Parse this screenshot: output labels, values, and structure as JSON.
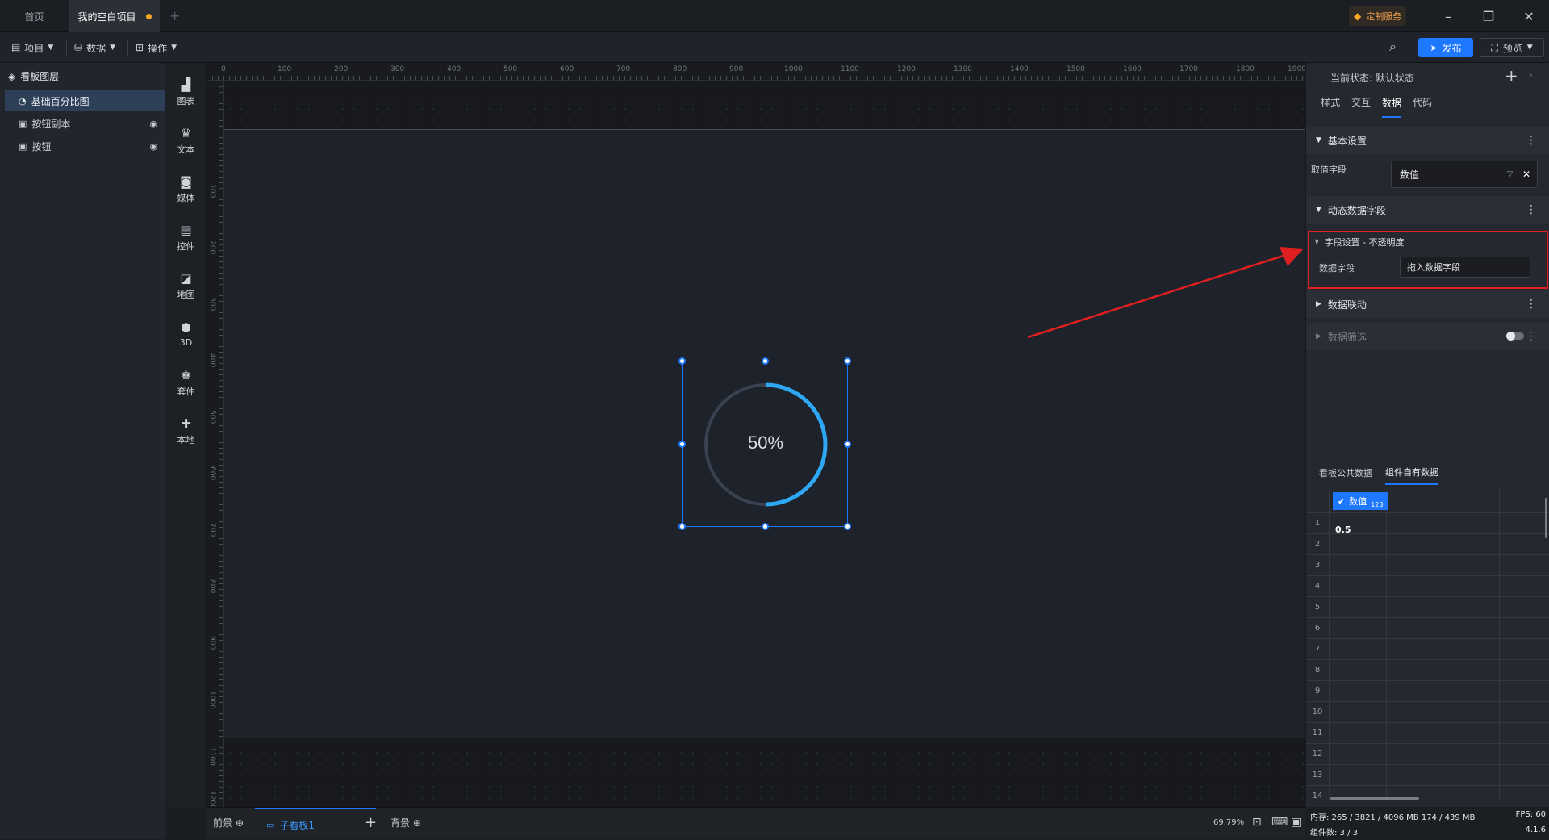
{
  "titlebar": {
    "tabs": [
      {
        "label": "首页"
      },
      {
        "label": "我的空白项目"
      }
    ],
    "custom_service": "定制服务"
  },
  "toolbar": {
    "menus": [
      {
        "label": "项目"
      },
      {
        "label": "数据"
      },
      {
        "label": "操作"
      }
    ],
    "publish": "发布",
    "preview": "预览"
  },
  "layers": {
    "title": "看板图层",
    "items": [
      {
        "label": "基础百分比图"
      },
      {
        "label": "按钮副本"
      },
      {
        "label": "按钮"
      }
    ]
  },
  "iconbar": {
    "items": [
      {
        "label": "图表",
        "icon": "chart-icon"
      },
      {
        "label": "文本",
        "icon": "text-icon"
      },
      {
        "label": "媒体",
        "icon": "media-icon"
      },
      {
        "label": "控件",
        "icon": "control-icon"
      },
      {
        "label": "地图",
        "icon": "map-icon"
      },
      {
        "label": "3D",
        "icon": "cube-icon"
      },
      {
        "label": "套件",
        "icon": "suite-icon"
      },
      {
        "label": "本地",
        "icon": "puzzle-icon"
      }
    ]
  },
  "ruler": {
    "top": [
      "0",
      "100",
      "200",
      "300",
      "400",
      "500",
      "600",
      "700",
      "800",
      "900",
      "1000",
      "1100",
      "1200",
      "1300",
      "1400",
      "1500",
      "1600",
      "1700",
      "1800",
      "1900"
    ],
    "left": [
      "100",
      "200",
      "300",
      "400",
      "500",
      "600",
      "700",
      "800",
      "900",
      "1000",
      "1100",
      "1200"
    ]
  },
  "canvas": {
    "gauge_label": "50%",
    "gauge_value": 0.5
  },
  "bottom": {
    "foreground": "前景",
    "sub_board": "子看板1",
    "background": "背景",
    "zoom": "69.79%"
  },
  "panel": {
    "state_label": "当前状态: 默认状态",
    "tabs": [
      {
        "label": "样式"
      },
      {
        "label": "交互"
      },
      {
        "label": "数据"
      },
      {
        "label": "代码"
      }
    ],
    "basic_settings": "基本设置",
    "value_field_label": "取值字段",
    "value_field_value": "数值",
    "dynamic_fields": "动态数据字段",
    "field_settings": "字段设置 - 不透明度",
    "data_field_label": "数据字段",
    "data_field_placeholder": "拖入数据字段",
    "data_link": "数据联动",
    "data_filter": "数据筛选",
    "data_tabs": [
      {
        "label": "看板公共数据"
      },
      {
        "label": "组件自有数据"
      }
    ],
    "column_header": "数值",
    "column_type": "123",
    "rows": [
      "1",
      "2",
      "3",
      "4",
      "5",
      "6",
      "7",
      "8",
      "9",
      "10",
      "11",
      "12",
      "13",
      "14"
    ],
    "cell_value": "0.5"
  },
  "status": {
    "memory": "内存: 265 / 3821 / 4096 MB  174 / 439 MB",
    "fps": "FPS: 60",
    "components": "组件数: 3 / 3",
    "version": "4.1.6"
  },
  "colors": {
    "accent": "#1e78ff",
    "gauge": "#2ea8f5",
    "highlight": "#e02020"
  }
}
